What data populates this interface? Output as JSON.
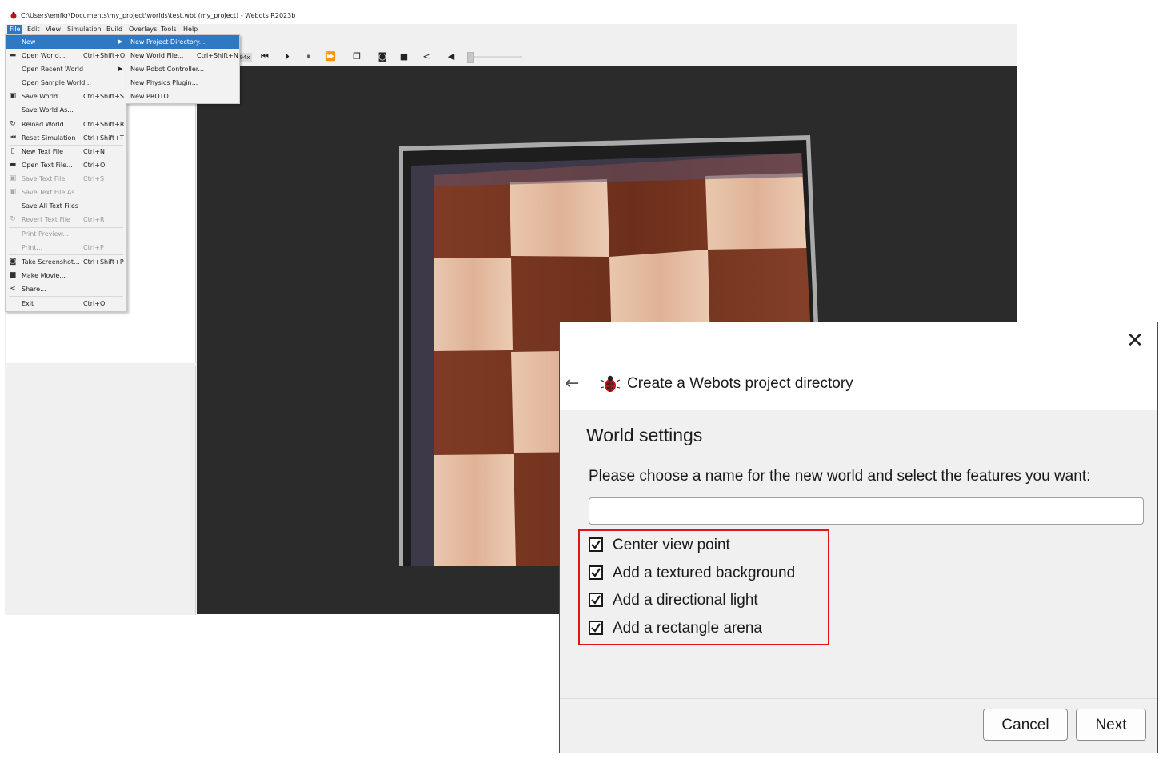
{
  "window": {
    "title": "C:\\Users\\emfkr\\Documents\\my_project\\worlds\\test.wbt (my_project) - Webots R2023b"
  },
  "menubar": [
    "File",
    "Edit",
    "View",
    "Simulation",
    "Build",
    "Overlays",
    "Tools",
    "Help"
  ],
  "toolbar": {
    "speed": "94x",
    "icons": [
      "reset-icon",
      "step-icon",
      "pause-icon",
      "fast-forward-icon",
      "box-view-icon",
      "camera-icon",
      "movie-icon",
      "share-icon",
      "volume-icon"
    ]
  },
  "file_menu": {
    "items": [
      {
        "label": "New",
        "shortcut": "",
        "icon": "",
        "submenu": true,
        "highlighted": true,
        "disabled": false
      },
      {
        "label": "Open World...",
        "shortcut": "Ctrl+Shift+O",
        "icon": "folder-icon",
        "disabled": false
      },
      {
        "label": "Open Recent World",
        "shortcut": "",
        "icon": "",
        "submenu": true,
        "disabled": false
      },
      {
        "label": "Open Sample World...",
        "shortcut": "",
        "icon": "",
        "disabled": false
      },
      {
        "label": "Save World",
        "shortcut": "Ctrl+Shift+S",
        "icon": "save-icon",
        "disabled": false
      },
      {
        "label": "Save World As...",
        "shortcut": "",
        "icon": "",
        "disabled": false
      },
      {
        "label": "Reload World",
        "shortcut": "Ctrl+Shift+R",
        "icon": "reload-icon",
        "disabled": false
      },
      {
        "label": "Reset Simulation",
        "shortcut": "Ctrl+Shift+T",
        "icon": "reset-icon",
        "disabled": false
      },
      {
        "label": "New Text File",
        "shortcut": "Ctrl+N",
        "icon": "file-icon",
        "disabled": false
      },
      {
        "label": "Open Text File...",
        "shortcut": "Ctrl+O",
        "icon": "folder-icon",
        "disabled": false
      },
      {
        "label": "Save Text File",
        "shortcut": "Ctrl+S",
        "icon": "save-icon",
        "disabled": true
      },
      {
        "label": "Save Text File As...",
        "shortcut": "",
        "icon": "save-icon",
        "disabled": true
      },
      {
        "label": "Save All Text Files",
        "shortcut": "",
        "icon": "",
        "disabled": false
      },
      {
        "label": "Revert Text File",
        "shortcut": "Ctrl+R",
        "icon": "reload-icon",
        "disabled": true
      },
      {
        "label": "Print Preview...",
        "shortcut": "",
        "icon": "",
        "disabled": true
      },
      {
        "label": "Print...",
        "shortcut": "Ctrl+P",
        "icon": "",
        "disabled": true
      },
      {
        "label": "Take Screenshot...",
        "shortcut": "Ctrl+Shift+P",
        "icon": "camera-icon",
        "disabled": false
      },
      {
        "label": "Make Movie...",
        "shortcut": "",
        "icon": "movie-icon",
        "disabled": false
      },
      {
        "label": "Share...",
        "shortcut": "",
        "icon": "share-icon",
        "disabled": false
      },
      {
        "label": "Exit",
        "shortcut": "Ctrl+Q",
        "icon": "",
        "disabled": false
      }
    ]
  },
  "new_menu": {
    "items": [
      {
        "label": "New Project Directory...",
        "shortcut": "",
        "highlighted": true
      },
      {
        "label": "New World File...",
        "shortcut": "Ctrl+Shift+N"
      },
      {
        "label": "New Robot Controller...",
        "shortcut": ""
      },
      {
        "label": "New Physics Plugin...",
        "shortcut": ""
      },
      {
        "label": "New PROTO...",
        "shortcut": ""
      }
    ]
  },
  "dialog": {
    "title": "Create a Webots project directory",
    "heading": "World settings",
    "instruction": "Please choose a name for the new world and select the features you want:",
    "world_name_value": "",
    "options": [
      {
        "label": "Center view point",
        "checked": true
      },
      {
        "label": "Add a textured background",
        "checked": true
      },
      {
        "label": "Add a directional light",
        "checked": true
      },
      {
        "label": "Add a rectangle arena",
        "checked": true
      }
    ],
    "cancel_label": "Cancel",
    "next_label": "Next"
  },
  "colors": {
    "menu_highlight": "#2f78c4",
    "annotation_red": "#e0141b",
    "viewport_bg": "#2b2b2b",
    "wood_light": "#e6c1a6",
    "wood_dark": "#7a3721"
  }
}
